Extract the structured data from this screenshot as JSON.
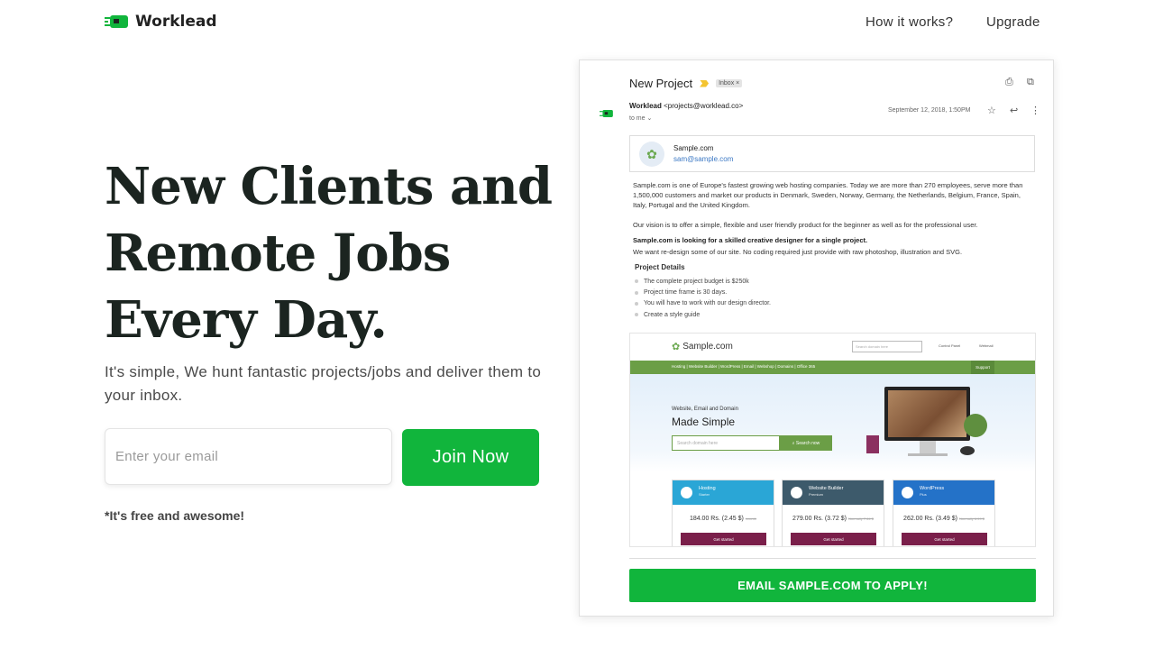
{
  "nav": {
    "brand": "Worklead",
    "links": [
      "How it works?",
      "Upgrade"
    ]
  },
  "hero": {
    "title_lines": [
      "New Clients and",
      "Remote Jobs",
      "Every Day."
    ],
    "subtitle": "It's simple, We hunt fantastic projects/jobs and deliver them to your inbox.",
    "email_placeholder": "Enter your email",
    "join_label": "Join Now",
    "note": "*It's free and awesome!"
  },
  "email": {
    "subject": "New Project",
    "tag": "Inbox ×",
    "sender_name": "Worklead",
    "sender_address": "<projects@worklead.co>",
    "to": "to me ⌄",
    "date": "September 12, 2018, 1:50PM",
    "contact_name": "Sample.com",
    "contact_email": "sam@sample.com",
    "para1": "Sample.com is one of Europe's fastest growing web hosting companies. Today we are more than 270 employees, serve more than 1,500,000 customers and market our products in Denmark, Sweden, Norway, Germany, the Netherlands, Belgium, France, Spain, Italy, Portugal and the United Kingdom.",
    "para2": "Our vision is to offer a simple, flexible and user friendly product for the beginner as well as for the professional user.",
    "para3_bold": "Sample.com is looking for a skilled creative designer for a single project.",
    "para3": "We want re-design some of our site. No coding required just provide with raw photoshop, illustration and SVG.",
    "details_title": "Project Details",
    "details": [
      "The complete project budget is $250k",
      "Project time frame is 30 days.",
      "You will have to work with our design director.",
      "Create a style guide"
    ],
    "apply_label": "EMAIL SAMPLE.COM TO APPLY!"
  },
  "site": {
    "logo": "Sample.com",
    "search_placeholder": "Search domain here",
    "top_links": [
      "Control Panel",
      "Webmail"
    ],
    "menu": "Hosting  |  Website Builder  |  WordPress  |  Email  |  Webshop  |  Domains  |  Office 365",
    "support": "Support",
    "hero_small": "Website, Email and Domain",
    "hero_big": "Made Simple",
    "domain_placeholder": "Search domain here",
    "domain_button": "⌕ Search now",
    "plans": [
      {
        "name": "Hosting",
        "tier": "Starter",
        "price": "184.00 Rs. (2.45 $)",
        "old": "/month",
        "button": "Get started",
        "color": "#2aa6d6"
      },
      {
        "name": "Website Builder",
        "tier": "Premium",
        "price": "279.00 Rs. (3.72 $)",
        "old": "Normally 7.44 $",
        "button": "Get started",
        "color": "#3d5a6b"
      },
      {
        "name": "WordPress",
        "tier": "Plus",
        "price": "262.00 Rs. (3.49 $)",
        "old": "Normally 6.99 $",
        "button": "Get started",
        "color": "#2472c8"
      }
    ]
  },
  "colors": {
    "accent": "#11b53c",
    "text_dark": "#1b2420"
  },
  "icons": [
    "worklead-logo-icon",
    "print-icon",
    "open-external-icon",
    "star-icon",
    "reply-icon",
    "more-icon"
  ]
}
